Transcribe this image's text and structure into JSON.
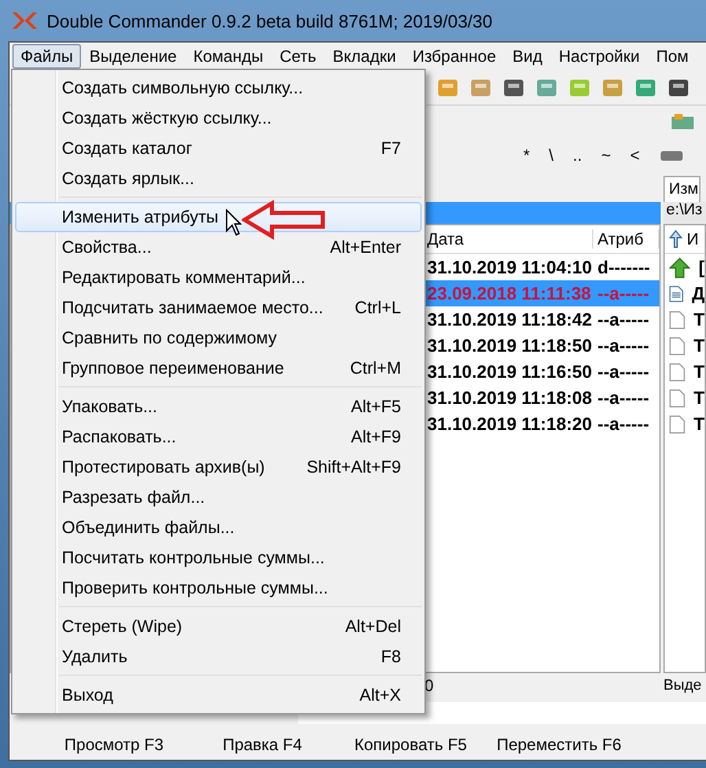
{
  "window": {
    "title": "Double Commander 0.9.2 beta build 8761M; 2019/03/30"
  },
  "menubar": [
    {
      "label": "Файлы",
      "selected": true
    },
    {
      "label": "Выделение",
      "selected": false
    },
    {
      "label": "Команды",
      "selected": false
    },
    {
      "label": "Сеть",
      "selected": false
    },
    {
      "label": "Вкладки",
      "selected": false
    },
    {
      "label": "Избранное",
      "selected": false
    },
    {
      "label": "Вид",
      "selected": false
    },
    {
      "label": "Настройки",
      "selected": false
    },
    {
      "label": "Пом",
      "selected": false
    }
  ],
  "path_shortcuts": [
    "*",
    "\\",
    "..",
    "~",
    "<"
  ],
  "left_panel": {
    "columns": [
      "Дата",
      "Атриб"
    ],
    "rows": [
      {
        "date": "31.10.2019 11:04:10",
        "attributes": "d-------",
        "selected": false
      },
      {
        "date": "23.09.2018 11:11:38",
        "attributes": "--a-----",
        "selected": true
      },
      {
        "date": "31.10.2019 11:18:42",
        "attributes": "--a-----",
        "selected": false
      },
      {
        "date": "31.10.2019 11:18:50",
        "attributes": "--a-----",
        "selected": false
      },
      {
        "date": "31.10.2019 11:16:50",
        "attributes": "--a-----",
        "selected": false
      },
      {
        "date": "31.10.2019 11:18:08",
        "attributes": "--a-----",
        "selected": false
      },
      {
        "date": "31.10.2019 11:18:20",
        "attributes": "--a-----",
        "selected": false
      }
    ],
    "status": "0"
  },
  "right_panel": {
    "tab": "Изм",
    "path": "e:\\Из",
    "column": "И",
    "rows": [
      {
        "kind": "up",
        "name": "["
      },
      {
        "kind": "document",
        "name": "Д"
      },
      {
        "kind": "file",
        "name": "Т"
      },
      {
        "kind": "file",
        "name": "Т"
      },
      {
        "kind": "file",
        "name": "Т"
      },
      {
        "kind": "file",
        "name": "Т"
      },
      {
        "kind": "file",
        "name": "Т"
      }
    ],
    "status": "Выде"
  },
  "function_keys": [
    "Просмотр F3",
    "Правка F4",
    "Копировать F5",
    "Переместить F6"
  ],
  "menu": {
    "items": [
      {
        "kind": "item",
        "label": "Создать символьную ссылку...",
        "highlighted": false
      },
      {
        "kind": "item",
        "label": "Создать жёсткую ссылку...",
        "highlighted": false
      },
      {
        "kind": "item",
        "label": "Создать каталог",
        "shortcut": "F7",
        "highlighted": false
      },
      {
        "kind": "item",
        "label": "Создать ярлык...",
        "highlighted": false
      },
      {
        "kind": "separator"
      },
      {
        "kind": "item",
        "label": "Изменить атрибуты",
        "highlighted": true
      },
      {
        "kind": "item",
        "label": "Свойства...",
        "shortcut": "Alt+Enter",
        "highlighted": false
      },
      {
        "kind": "item",
        "label": "Редактировать комментарий...",
        "highlighted": false
      },
      {
        "kind": "item",
        "label": "Подсчитать занимаемое место...",
        "shortcut": "Ctrl+L",
        "highlighted": false
      },
      {
        "kind": "item",
        "label": "Сравнить по содержимому",
        "highlighted": false
      },
      {
        "kind": "item",
        "label": "Групповое переименование",
        "shortcut": "Ctrl+M",
        "highlighted": false
      },
      {
        "kind": "separator"
      },
      {
        "kind": "item",
        "label": "Упаковать...",
        "shortcut": "Alt+F5",
        "highlighted": false
      },
      {
        "kind": "item",
        "label": "Распаковать...",
        "shortcut": "Alt+F9",
        "highlighted": false
      },
      {
        "kind": "item",
        "label": "Протестировать архив(ы)",
        "shortcut": "Shift+Alt+F9",
        "highlighted": false
      },
      {
        "kind": "item",
        "label": "Разрезать файл...",
        "highlighted": false
      },
      {
        "kind": "item",
        "label": "Объединить файлы...",
        "highlighted": false
      },
      {
        "kind": "item",
        "label": "Посчитать контрольные суммы...",
        "highlighted": false
      },
      {
        "kind": "item",
        "label": "Проверить контрольные суммы...",
        "highlighted": false
      },
      {
        "kind": "separator"
      },
      {
        "kind": "item",
        "label": "Стереть (Wipe)",
        "shortcut": "Alt+Del",
        "highlighted": false
      },
      {
        "kind": "item",
        "label": "Удалить",
        "shortcut": "F8",
        "highlighted": false
      },
      {
        "kind": "separator"
      },
      {
        "kind": "item",
        "label": "Выход",
        "shortcut": "Alt+X",
        "highlighted": false
      }
    ]
  }
}
